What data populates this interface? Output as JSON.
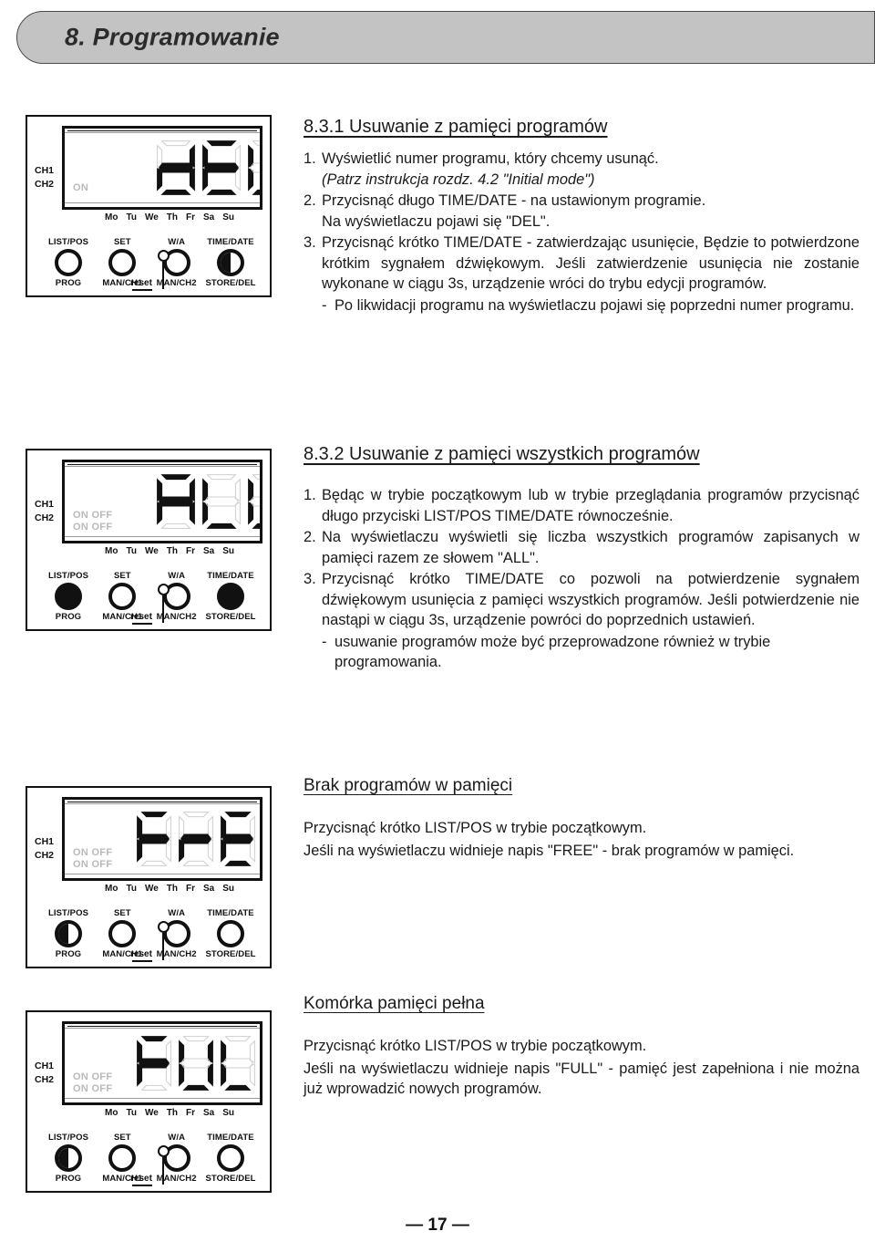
{
  "header": {
    "title": "8. Programowanie"
  },
  "footer": {
    "page_number": "— 17 —"
  },
  "device_common": {
    "ch1_label": "CH1",
    "ch2_label": "CH2",
    "weekdays": [
      "Mo",
      "Tu",
      "We",
      "Th",
      "Fr",
      "Sa",
      "Su"
    ],
    "buttons": [
      {
        "top": "LIST/POS",
        "bottom": "PROG"
      },
      {
        "top": "SET",
        "bottom": "MAN/CH1"
      },
      {
        "top": "W/A",
        "bottom": "MAN/CH2"
      },
      {
        "top": "TIME/DATE",
        "bottom": "STORE/DEL"
      }
    ],
    "reset_label": "reset"
  },
  "devices": [
    {
      "name": "device-del",
      "display_text": "dEL",
      "segments": [
        "d",
        "E",
        "L"
      ],
      "prog_digits": "88",
      "indicators": [
        "ON"
      ],
      "knob_states": [
        "empty",
        "empty",
        "empty",
        "half"
      ]
    },
    {
      "name": "device-all",
      "display_text": "ALL",
      "segments": [
        "A",
        "L",
        "L"
      ],
      "prog_digits": "88",
      "indicators": [
        "ON OFF",
        "ON OFF"
      ],
      "knob_states": [
        "filled",
        "empty",
        "empty",
        "filled"
      ]
    },
    {
      "name": "device-free",
      "display_text": "FrEE",
      "segments": [
        "F",
        "r",
        "E",
        "E"
      ],
      "prog_digits": "",
      "indicators": [
        "ON OFF",
        "ON OFF"
      ],
      "knob_states": [
        "half",
        "empty",
        "empty",
        "empty"
      ]
    },
    {
      "name": "device-full",
      "display_text": "FULL",
      "segments": [
        "F",
        "U",
        "L",
        "L"
      ],
      "prog_digits": "",
      "indicators": [
        "ON OFF",
        "ON OFF"
      ],
      "knob_states": [
        "half",
        "empty",
        "empty",
        "empty"
      ]
    }
  ],
  "sections": {
    "s831": {
      "heading": "8.3.1 Usuwanie z pamięci programów",
      "steps": [
        {
          "num": "1.",
          "lines": [
            {
              "text": "Wyświetlić numer programu, który chcemy usunąć.",
              "style": "normal"
            },
            {
              "text": "(Patrz instrukcja rozdz. 4.2 \"Initial mode\")",
              "style": "italic"
            }
          ]
        },
        {
          "num": "2.",
          "lines": [
            {
              "text": "Przycisnąć długo TIME/DATE - na ustawionym programie.",
              "style": "normal"
            },
            {
              "text": "Na wyświetlaczu pojawi się \"DEL\".",
              "style": "normal"
            }
          ]
        },
        {
          "num": "3.",
          "lines": [
            {
              "text": "Przycisnąć krótko TIME/DATE - zatwierdzając usunięcie, Będzie to potwierdzone krótkim sygnałem dźwiękowym. Jeśli zatwierdzenie usunięcia nie zostanie wykonane w ciągu 3s, urządzenie wróci do trybu edycji programów.",
              "style": "justify"
            }
          ]
        }
      ],
      "dash_items": [
        {
          "dash": "-",
          "text": "Po likwidacji programu na wyświetlaczu pojawi się poprzedni numer programu."
        }
      ]
    },
    "s832": {
      "heading": "8.3.2 Usuwanie z pamięci wszystkich programów",
      "steps": [
        {
          "num": "1.",
          "lines": [
            {
              "text": "Będąc w trybie początkowym lub w trybie przeglądania programów przycisnąć długo przyciski LIST/POS TIME/DATE równocześnie.",
              "style": "justify"
            }
          ]
        },
        {
          "num": "2.",
          "lines": [
            {
              "text": "Na wyświetlaczu wyświetli się liczba wszystkich programów zapisanych w pamięci razem ze słowem \"ALL\".",
              "style": "justify"
            }
          ]
        },
        {
          "num": "3.",
          "lines": [
            {
              "text": "Przycisnąć krótko TIME/DATE co pozwoli na potwierdzenie sygnałem dźwiękowym usunięcia z pamięci wszystkich programów. Jeśli potwierdzenie nie nastąpi w ciągu 3s, urządzenie powróci do poprzednich ustawień.",
              "style": "justify"
            }
          ]
        }
      ],
      "dash_items": [
        {
          "dash": "-",
          "text": "usuwanie programów może być przeprowadzone również w trybie programowania."
        }
      ]
    },
    "s_free": {
      "heading": "Brak programów w pamięci",
      "paragraphs": [
        {
          "text": "Przycisnąć krótko LIST/POS w trybie początkowym.",
          "style": "normal"
        },
        {
          "text": "Jeśli na wyświetlaczu widnieje napis \"FREE\" - brak programów w pamięci.",
          "style": "justify"
        }
      ]
    },
    "s_full": {
      "heading": "Komórka pamięci pełna",
      "paragraphs": [
        {
          "text": "Przycisnąć krótko LIST/POS w trybie początkowym.",
          "style": "normal"
        },
        {
          "text": "Jeśli na wyświetlaczu widnieje napis \"FULL\" - pamięć jest zapełniona i nie można już wprowadzić nowych programów.",
          "style": "justify"
        }
      ]
    }
  }
}
